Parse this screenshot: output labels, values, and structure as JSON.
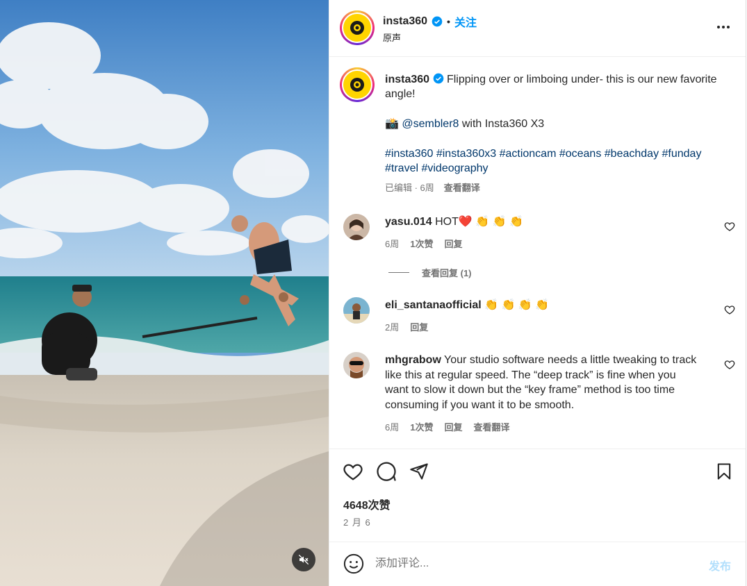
{
  "post": {
    "username": "insta360",
    "follow_label": "关注",
    "separator": "•",
    "audio_label": "原声"
  },
  "caption": {
    "username": "insta360",
    "text_line1": "Flipping over or limboing under- this is our new favorite angle!",
    "camera_emoji": "📸",
    "mention": "@sembler8",
    "mention_suffix": " with Insta360 X3",
    "hashtags": "#insta360 #insta360x3 #actioncam #oceans #beachday #funday #travel #videography",
    "edited": "已编辑 · 6周",
    "translate": "查看翻译"
  },
  "comments": [
    {
      "username": "yasu.014",
      "text": "HOT❤️ 👏 👏 👏",
      "time": "6周",
      "likes": "1次赞",
      "reply": "回复",
      "view_replies": "查看回复 (1)"
    },
    {
      "username": "eli_santanaofficial",
      "text": "👏 👏 👏 👏",
      "time": "2周",
      "reply": "回复"
    },
    {
      "username": "mhgrabow",
      "text": "Your studio software needs a little tweaking to track like this at regular speed. The “deep track” is fine when you want to slow it down but the “key frame” method is too time consuming if you want it to be smooth.",
      "time": "6周",
      "likes": "1次赞",
      "reply": "回复",
      "translate": "查看翻译"
    }
  ],
  "stats": {
    "likes": "4648次赞",
    "date": "2 月 6"
  },
  "composer": {
    "placeholder": "添加评论...",
    "post_label": "发布"
  },
  "icons": {
    "like": "heart-icon",
    "comment": "comment-bubble-icon",
    "share": "send-icon",
    "save": "bookmark-icon",
    "emoji": "smiley-icon",
    "mute": "speaker-muted-icon",
    "more": "more-horizontal-icon",
    "verified": "verified-badge-icon"
  },
  "colors": {
    "accent": "#0095f6",
    "link": "#00376b",
    "muted_text": "#737373",
    "heart_red": "#ff3040",
    "post_disabled": "#b2dffc"
  }
}
